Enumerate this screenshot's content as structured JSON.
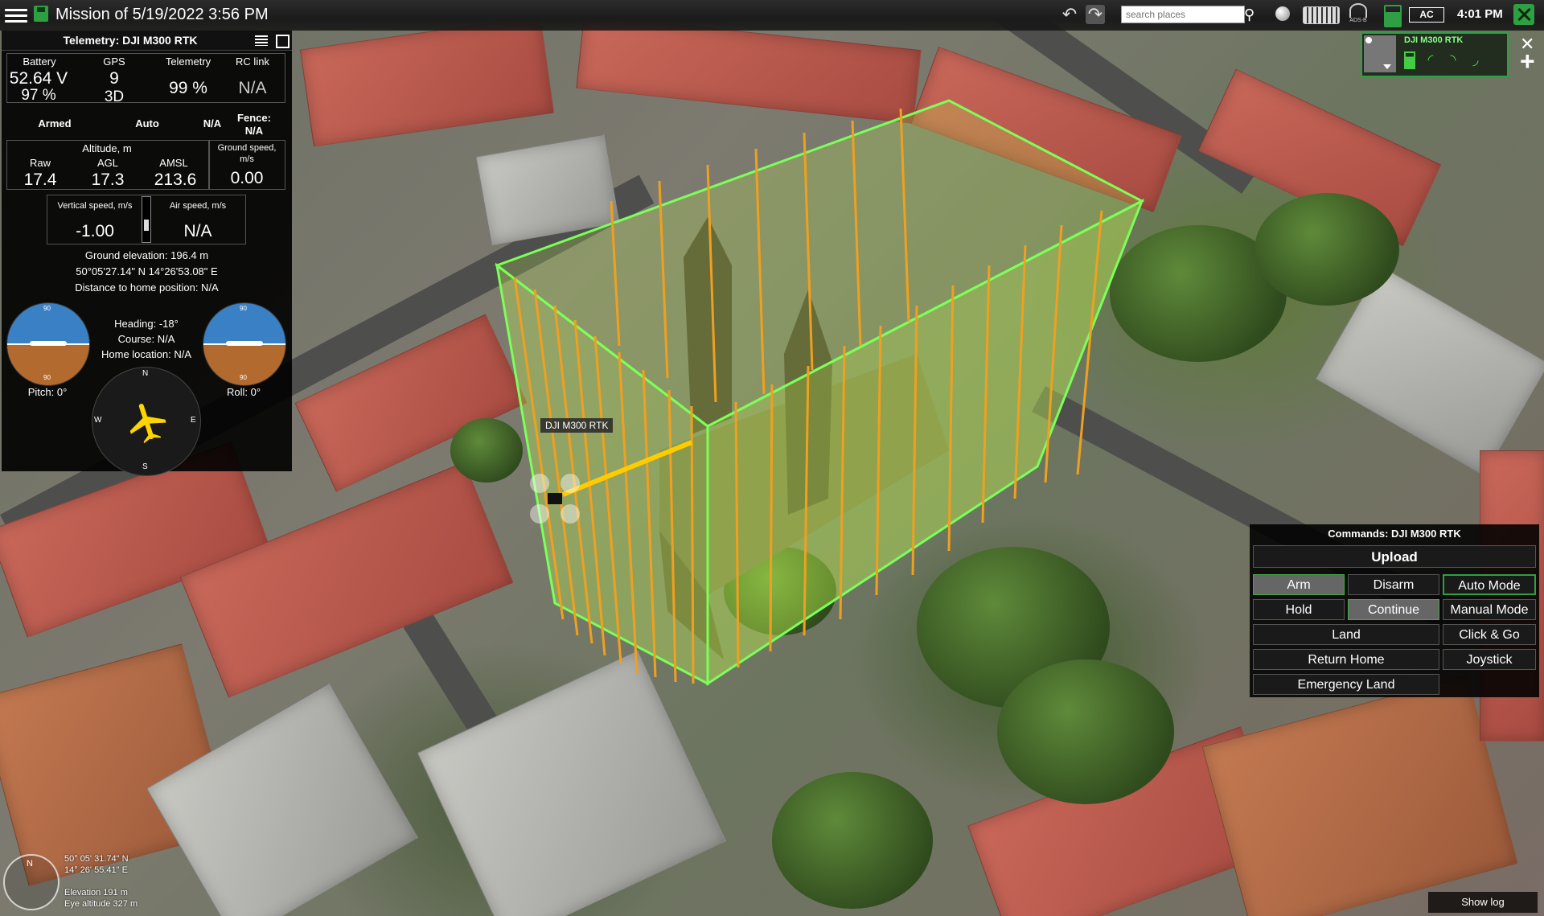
{
  "header": {
    "mission_title": "Mission of 5/19/2022 3:56 PM",
    "search_placeholder": "search places",
    "adsb_label": "ADS-B",
    "ac_badge": "AC",
    "clock": "4:01 PM"
  },
  "telemetry": {
    "title": "Telemetry: DJI M300 RTK",
    "battery_label": "Battery",
    "battery_voltage": "52.64 V",
    "battery_percent": "97 %",
    "gps_label": "GPS",
    "gps_sats": "9",
    "gps_fix": "3D",
    "telemetry_label": "Telemetry",
    "telemetry_value": "99 %",
    "rc_label": "RC link",
    "rc_value": "N/A",
    "armed": "Armed",
    "mode": "Auto",
    "mode_extra": "N/A",
    "fence_label": "Fence:",
    "fence_value": "N/A",
    "altitude_label": "Altitude, m",
    "raw_label": "Raw",
    "raw_value": "17.4",
    "agl_label": "AGL",
    "agl_value": "17.3",
    "amsl_label": "AMSL",
    "amsl_value": "213.6",
    "ground_speed_label": "Ground speed, m/s",
    "ground_speed_value": "0.00",
    "vertical_speed_label": "Vertical speed, m/s",
    "vertical_speed_value": "-1.00",
    "air_speed_label": "Air speed, m/s",
    "air_speed_value": "N/A",
    "ground_elevation": "Ground elevation: 196.4 m",
    "coordinates": "50°05'27.14\" N  14°26'53.08\" E",
    "distance_home": "Distance to home position: N/A",
    "heading": "Heading: -18°",
    "course": "Course: N/A",
    "home_location": "Home location: N/A",
    "pitch": "Pitch: 0°",
    "roll": "Roll: 0°",
    "adi_tick_top": "90",
    "adi_tick_bottom": "90",
    "compass_n": "N",
    "compass_s": "S",
    "compass_e": "E",
    "compass_w": "W"
  },
  "map": {
    "drone_label": "DJI M300 RTK",
    "cursor_lat": "50° 05' 31.74\" N",
    "cursor_lon": "14° 26' 55.41\" E",
    "elevation": "Elevation 191 m",
    "eye_altitude": "Eye altitude 327 m"
  },
  "vehicle_widget": {
    "name": "DJI M300 RTK"
  },
  "commands": {
    "title": "Commands: DJI M300 RTK",
    "upload": "Upload",
    "arm": "Arm",
    "disarm": "Disarm",
    "auto_mode": "Auto Mode",
    "hold": "Hold",
    "continue": "Continue",
    "manual_mode": "Manual Mode",
    "land": "Land",
    "click_go": "Click & Go",
    "return_home": "Return Home",
    "joystick": "Joystick",
    "emergency_land": "Emergency Land"
  },
  "footer": {
    "show_log": "Show log"
  },
  "colors": {
    "accent_green": "#2ea043",
    "flight_path": "#f0a020",
    "volume_fill": "#c8ff50"
  }
}
